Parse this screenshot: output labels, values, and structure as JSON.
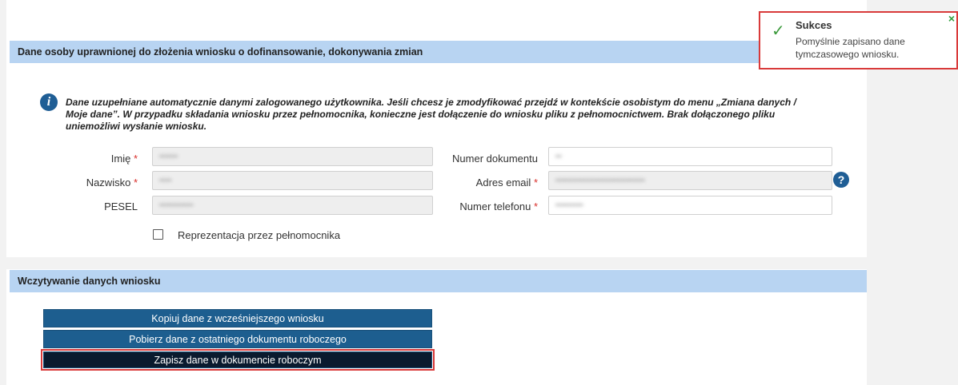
{
  "section_osoba": {
    "title": "Dane osoby uprawnionej do złożenia wniosku o dofinansowanie, dokonywania zmian",
    "info_text": "Dane uzupełniane automatycznie danymi zalogowanego użytkownika. Jeśli chcesz je zmodyfikować przejdź w kontekście osobistym do menu „Zmiana danych / Moje dane”. W przypadku składania wniosku przez pełnomocnika, konieczne jest dołączenie do wniosku pliku z pełnomocnictwem. Brak dołączonego pliku uniemożliwi wysłanie wniosku.",
    "fields": {
      "imie_label": "Imię",
      "nazwisko_label": "Nazwisko",
      "pesel_label": "PESEL",
      "numer_dokumentu_label": "Numer dokumentu",
      "adres_email_label": "Adres email",
      "numer_telefonu_label": "Numer telefonu",
      "required_marker": "*"
    },
    "checkbox_label": "Reprezentacja przez pełnomocnika",
    "checkbox_checked": false
  },
  "section_wczytywanie": {
    "title": "Wczytywanie danych wniosku",
    "buttons": {
      "kopiuj": "Kopiuj dane z wcześniejszego wniosku",
      "pobierz": "Pobierz dane z ostatniego dokumentu roboczego",
      "zapisz": "Zapisz dane w dokumencie roboczym"
    }
  },
  "toast": {
    "title": "Sukces",
    "message": "Pomyślnie zapisano dane tymczasowego wniosku.",
    "close_symbol": "×",
    "check_symbol": "✓"
  },
  "icons": {
    "info": "info-icon",
    "help": "help-icon",
    "success": "check-icon",
    "close": "close-icon"
  },
  "colors": {
    "section_header_bg": "#b8d4f2",
    "button_bg": "#1d5e8f",
    "button_active_bg": "#0a1a2e",
    "highlight_border": "#d93a3a",
    "success_green": "#3c9a3c",
    "required_red": "#d9302c"
  }
}
